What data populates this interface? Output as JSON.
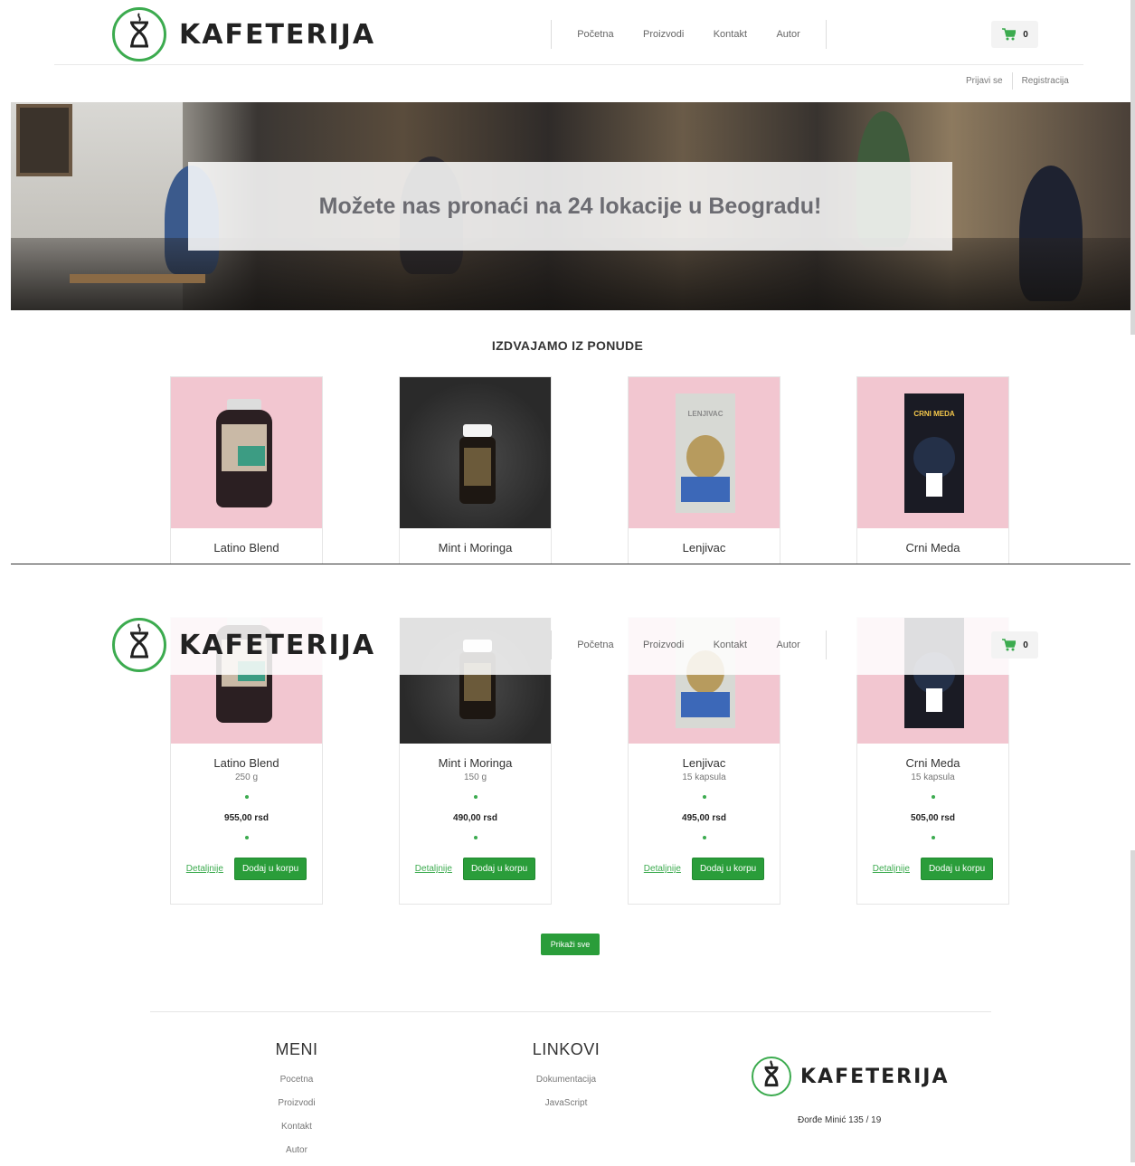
{
  "brand": {
    "name": "KAFETERIJA"
  },
  "nav": {
    "items": [
      "Početna",
      "Proizvodi",
      "Kontakt",
      "Autor"
    ]
  },
  "cart": {
    "count": "0",
    "icon": "cart-icon"
  },
  "auth": {
    "login": "Prijavi se",
    "register": "Registracija"
  },
  "hero": {
    "banner_text": "Možete nas pronaći na 24 lokacije u Beogradu!"
  },
  "featured": {
    "title": "IZDVAJAMO IZ PONUDE",
    "products": [
      {
        "name": "Latino Blend",
        "weight": "250 g",
        "price": "955,00 rsd"
      },
      {
        "name": "Mint i Moringa",
        "weight": "150 g",
        "price": "490,00 rsd"
      },
      {
        "name": "Lenjivac",
        "weight": "15 kapsula",
        "price": "495,00 rsd"
      },
      {
        "name": "Crni Meda",
        "weight": "15 kapsula",
        "price": "505,00 rsd"
      }
    ],
    "details_label": "Detaljnije",
    "add_label": "Dodaj u korpu",
    "show_all_label": "Prikaži sve",
    "box_labels": {
      "lenjivac": "LENJIVAC",
      "crni_meda": "CRNI MEDA"
    }
  },
  "footer": {
    "menu": {
      "title": "MENI",
      "items": [
        "Pocetna",
        "Proizvodi",
        "Kontakt",
        "Autor"
      ]
    },
    "links": {
      "title": "LINKOVI",
      "items": [
        "Dokumentacija",
        "JavaScript"
      ]
    },
    "copyright": "Đorđe Minić 135 / 19"
  },
  "colors": {
    "accent": "#3cab4f",
    "button": "#2a9d3a",
    "product_bg": "#f2c6d0"
  }
}
